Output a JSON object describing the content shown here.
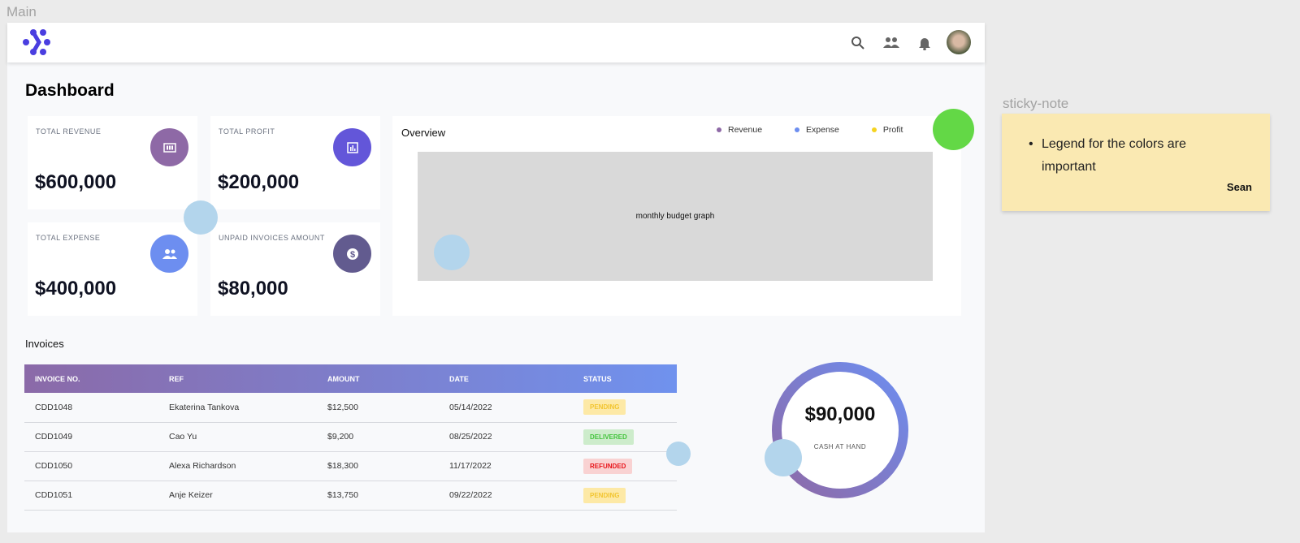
{
  "canvas": {
    "main_label": "Main",
    "sticky_label": "sticky-note"
  },
  "header": {
    "icons": [
      "search-icon",
      "people-icon",
      "bell-icon",
      "avatar"
    ]
  },
  "page_title": "Dashboard",
  "cards": [
    {
      "title": "TOTAL REVENUE",
      "value": "$600,000",
      "icon": "money-icon",
      "color": "#8e69a6"
    },
    {
      "title": "TOTAL PROFIT",
      "value": "$200,000",
      "icon": "chart-icon",
      "color": "#6356d9"
    },
    {
      "title": "TOTAL EXPENSE",
      "value": "$400,000",
      "icon": "people-icon",
      "color": "#6d8ef0"
    },
    {
      "title": "UNPAID INVOICES AMOUNT",
      "value": "$80,000",
      "icon": "dollar-icon",
      "color": "#625b8f"
    }
  ],
  "overview": {
    "title": "Overview",
    "legend": [
      {
        "label": "Revenue",
        "color": "#8e69a6"
      },
      {
        "label": "Expense",
        "color": "#6d8ef0"
      },
      {
        "label": "Profit",
        "color": "#f5d320"
      }
    ],
    "placeholder": "monthly budget graph"
  },
  "invoices": {
    "title": "Invoices",
    "columns": [
      "INVOICE NO.",
      "REF",
      "AMOUNT",
      "DATE",
      "STATUS"
    ],
    "rows": [
      {
        "no": "CDD1048",
        "ref": "Ekaterina Tankova",
        "amount": "$12,500",
        "date": "05/14/2022",
        "status": "PENDING"
      },
      {
        "no": "CDD1049",
        "ref": "Cao Yu",
        "amount": "$9,200",
        "date": "08/25/2022",
        "status": "DELIVERED"
      },
      {
        "no": "CDD1050",
        "ref": "Alexa Richardson",
        "amount": "$18,300",
        "date": "11/17/2022",
        "status": "REFUNDED"
      },
      {
        "no": "CDD1051",
        "ref": "Anje Keizer",
        "amount": "$13,750",
        "date": "09/22/2022",
        "status": "PENDING"
      }
    ]
  },
  "cash": {
    "value": "$90,000",
    "label": "CASH AT HAND"
  },
  "sticky": {
    "text": "Legend for the colors are important",
    "author": "Sean"
  }
}
